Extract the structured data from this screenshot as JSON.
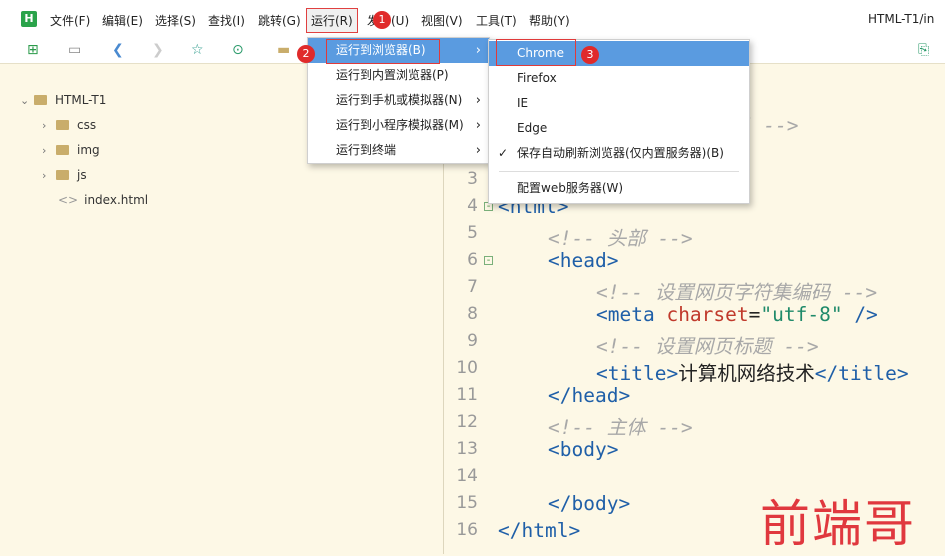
{
  "menubar": {
    "items": [
      "文件(F)",
      "编辑(E)",
      "选择(S)",
      "查找(I)",
      "跳转(G)",
      "运行(R)",
      "发行(U)",
      "视图(V)",
      "工具(T)",
      "帮助(Y)"
    ],
    "window_title": "HTML-T1/in"
  },
  "sidebar": {
    "project": "HTML-T1",
    "items": [
      "css",
      "img",
      "js",
      "index.html"
    ]
  },
  "run_menu": {
    "items": [
      "运行到浏览器(B)",
      "运行到内置浏览器(P)",
      "运行到手机或模拟器(N)",
      "运行到小程序模拟器(M)",
      "运行到终端"
    ]
  },
  "browser_menu": {
    "items": [
      "Chrome",
      "Firefox",
      "IE",
      "Edge",
      "保存自动刷新浏览器(仅内置服务器)(B)",
      "配置web服务器(W)"
    ],
    "checked": "保存自动刷新浏览器(仅内置服务器)(B)"
  },
  "badges": [
    "1",
    "2",
    "3"
  ],
  "editor": {
    "line_numbers": [
      "3",
      "4",
      "5",
      "6",
      "7",
      "8",
      "9",
      "10",
      "11",
      "12",
      "13",
      "14",
      "15",
      "16"
    ],
    "line1_fragment": "L5 -->",
    "lines": {
      "l4": "<html>",
      "l5": "<!-- 头部 -->",
      "l6": "<head>",
      "l7": "<!-- 设置网页字符集编码 -->",
      "l8_tag": "<meta ",
      "l8_attr": "charset",
      "l8_eq": "=",
      "l8_val": "\"utf-8\"",
      "l8_end": " />",
      "l9": "<!-- 设置网页标题 -->",
      "l10_open": "<title>",
      "l10_text": "计算机网络技术",
      "l10_close": "</title>",
      "l11": "</head>",
      "l12": "<!-- 主体 -->",
      "l13": "<body>",
      "l15": "</body>",
      "l16": "</html>"
    }
  },
  "watermark": "前端哥",
  "colors": {
    "highlight": "#5a9be0",
    "badge": "#e02a2a",
    "tag": "#1f5fa8",
    "attr": "#c0392b",
    "string": "#1f8a6a",
    "comment": "#a8a8a8",
    "background": "#fdf8e6"
  }
}
